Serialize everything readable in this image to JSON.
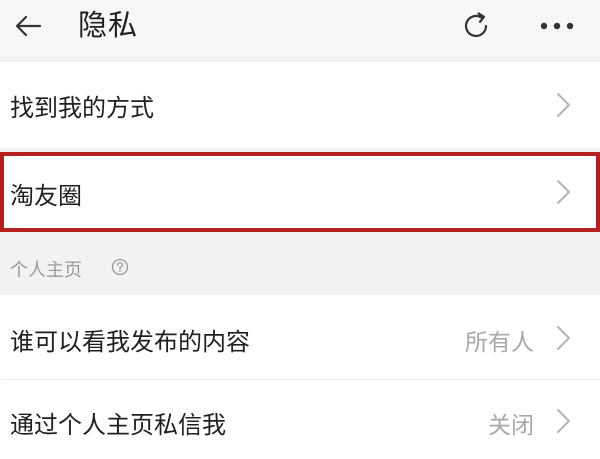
{
  "header": {
    "title": "隐私",
    "back_icon": "arrow-left-icon",
    "refresh_icon": "refresh-icon",
    "more_icon": "more-horizontal-icon"
  },
  "rows": {
    "find_me": {
      "label": "找到我的方式"
    },
    "taoyouquan": {
      "label": "淘友圈",
      "highlight_color": "#b3201f"
    }
  },
  "section": {
    "title": "个人主页",
    "help_icon": "question-circle-icon"
  },
  "profile_rows": {
    "who_can_see": {
      "label": "谁可以看我发布的内容",
      "value": "所有人"
    },
    "private_message": {
      "label": "通过个人主页私信我",
      "value": "关闭"
    }
  }
}
